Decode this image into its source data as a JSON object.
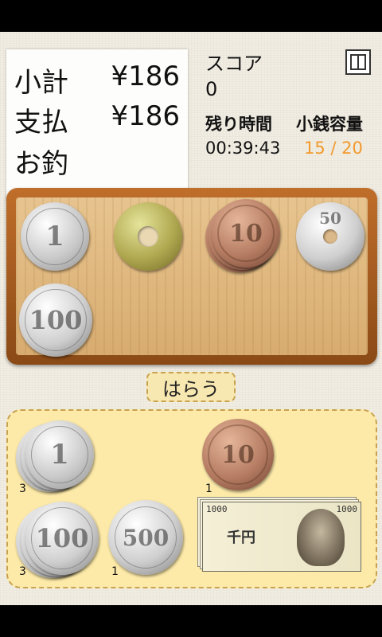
{
  "receipt": {
    "subtotal_label": "小計",
    "subtotal_value": "¥186",
    "paid_label": "支払",
    "paid_value": "¥186",
    "change_label": "お釣",
    "change_value": ""
  },
  "score": {
    "label": "スコア",
    "value": "0"
  },
  "time": {
    "label": "残り時間",
    "value": "00:39:43"
  },
  "capacity": {
    "label": "小銭容量",
    "value": "15 / 20",
    "color": "#f29a2e"
  },
  "menu_icon": "window-icon",
  "tray_coins": [
    {
      "denomination": "1",
      "type": "aluminum"
    },
    {
      "denomination": "5",
      "type": "brass"
    },
    {
      "denomination": "10",
      "type": "bronze",
      "stacked": true
    },
    {
      "denomination": "50",
      "type": "silver"
    },
    {
      "denomination": "100",
      "type": "silver"
    }
  ],
  "pay_button": {
    "label": "はらう"
  },
  "wallet": [
    {
      "denomination": "1",
      "count": "3"
    },
    {
      "denomination": "10",
      "count": "1"
    },
    {
      "denomination": "100",
      "count": "3"
    },
    {
      "denomination": "500",
      "count": "1"
    },
    {
      "denomination": "1000",
      "count": ""
    }
  ],
  "bill": {
    "number": "1000",
    "title": "千円"
  },
  "colors": {
    "background": "#f1ede2",
    "tray_frame": "#a85e22",
    "wallet_bg": "#fdeaa9",
    "capacity_accent": "#f29a2e"
  }
}
